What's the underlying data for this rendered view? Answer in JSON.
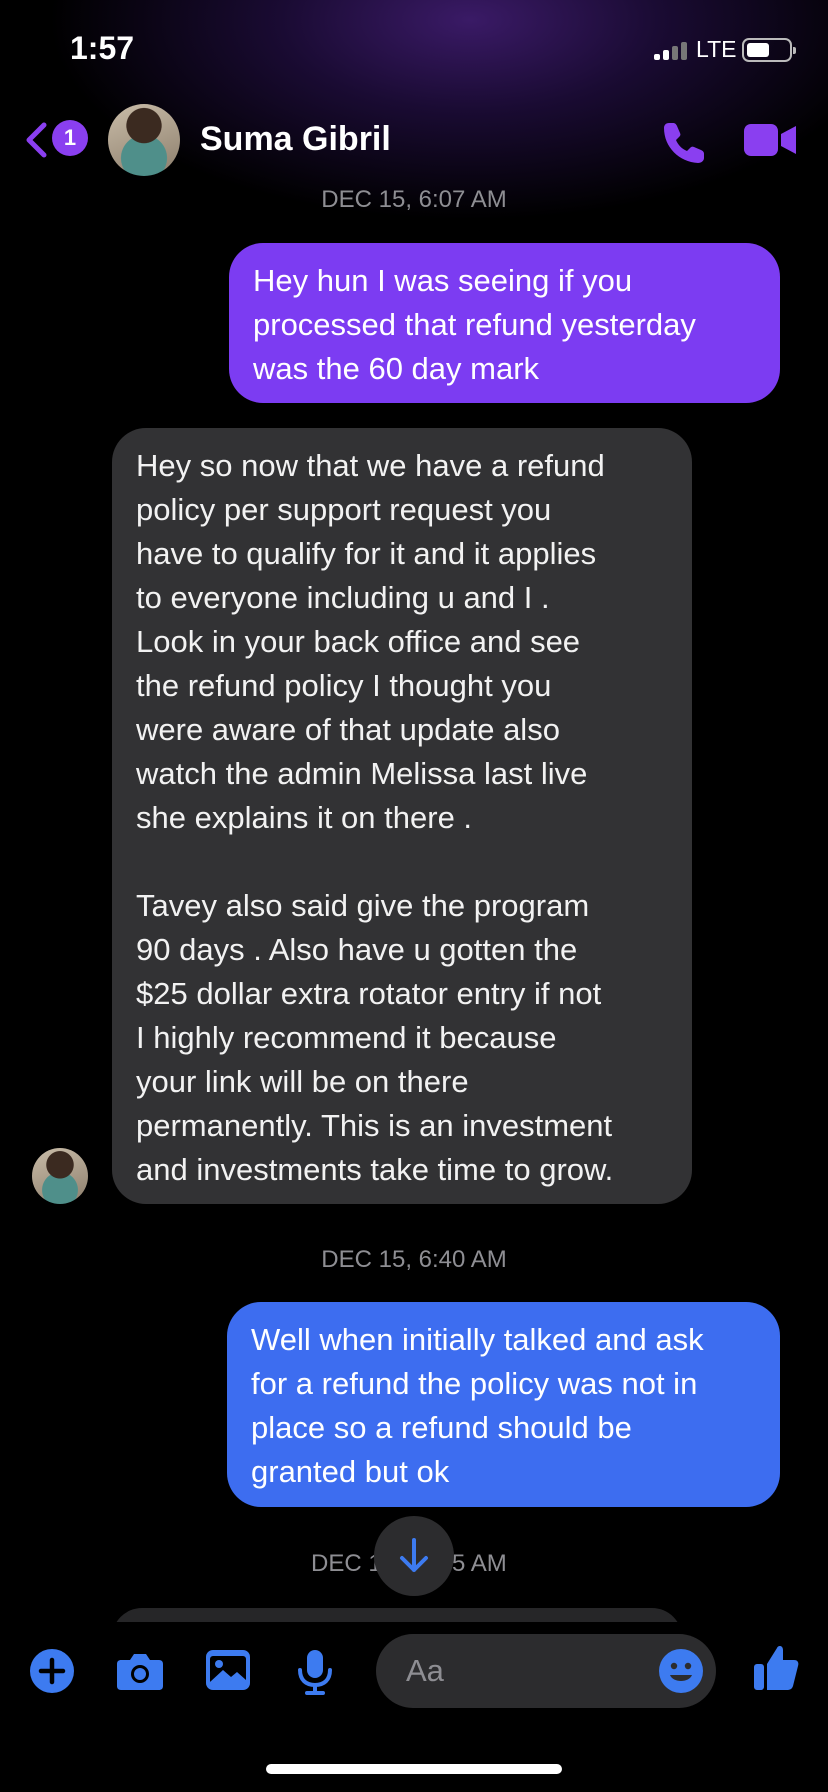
{
  "status_bar": {
    "time": "1:57",
    "network": "LTE",
    "battery_level": 0.5
  },
  "header": {
    "back_badge": "1",
    "contact_name": "Suma Gibril",
    "icons": [
      "chevron-left-icon",
      "phone-icon",
      "video-camera-icon"
    ],
    "accent_color": "#8a3ff0"
  },
  "thread": {
    "timestamp_1": "DEC 15, 6:07 AM",
    "msg_1": "Hey hun I was seeing if you\nprocessed that refund yesterday\nwas the 60 day mark",
    "msg_2": "Hey so now that we have a refund\npolicy per support request you\nhave to qualify for it and it applies\nto everyone including u and I .\nLook in your back office and see\nthe refund policy I thought you\nwere aware of that update also\nwatch the admin Melissa last live\nshe explains it on there .\n\nTavey also said give the program\n90 days . Also have u gotten the\n$25 dollar extra rotator entry if not\nI highly recommend it because\nyour link will be on there\npermanently. This is an investment\nand investments take time to grow.",
    "timestamp_2": "DEC 15, 6:40 AM",
    "msg_3": "Well when initially talked and ask\nfor a refund the policy was not in\nplace so a refund should be\ngranted but ok",
    "timestamp_3_left": "DEC 1",
    "timestamp_3_right": "5 AM",
    "outgoing_colors": [
      "#7c3cf2",
      "#3d6df0"
    ],
    "incoming_color": "#323234"
  },
  "composer": {
    "placeholder": "Aa",
    "icons": [
      "plus-icon",
      "camera-icon",
      "photo-icon",
      "microphone-icon",
      "emoji-icon",
      "thumbs-up-icon"
    ],
    "icon_color": "#3d7bf0"
  }
}
